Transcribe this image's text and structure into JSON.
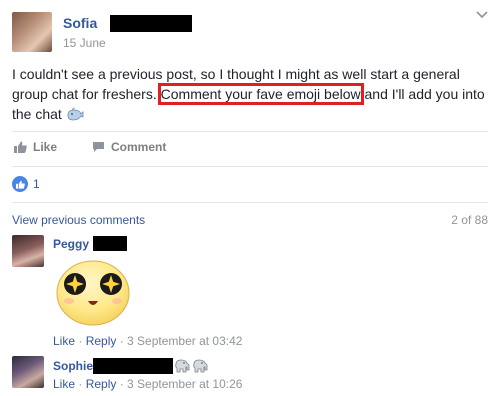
{
  "post": {
    "author": "Sofia",
    "date": "15 June",
    "text_before": "I couldn't see a previous post, so I thought I might as well start a general group chat for freshers. ",
    "text_highlight": "Comment your fave emoji below",
    "text_after": " and I'll add you into the chat"
  },
  "actions": {
    "like_label": "Like",
    "comment_label": "Comment"
  },
  "reactions": {
    "count": "1"
  },
  "comments_header": {
    "view_previous": "View previous comments",
    "count": "2 of 88"
  },
  "comments": [
    {
      "name": "Peggy",
      "like": "Like",
      "reply": "Reply",
      "sep": " · ",
      "timestamp": "3 September at 03:42"
    },
    {
      "name": "Sophie",
      "like": "Like",
      "reply": "Reply",
      "sep": " · ",
      "timestamp": "3 September at 10:26"
    }
  ],
  "colors": {
    "link": "#365899",
    "highlight_box": "#e02020",
    "like_badge": "#4a84e8"
  },
  "icons": [
    "chevron-down-icon",
    "whale-emoji-icon",
    "thumbs-up-icon",
    "comment-icon",
    "like-badge-icon",
    "elephant-emoji-icon",
    "starry-eyed-sticker-icon"
  ]
}
